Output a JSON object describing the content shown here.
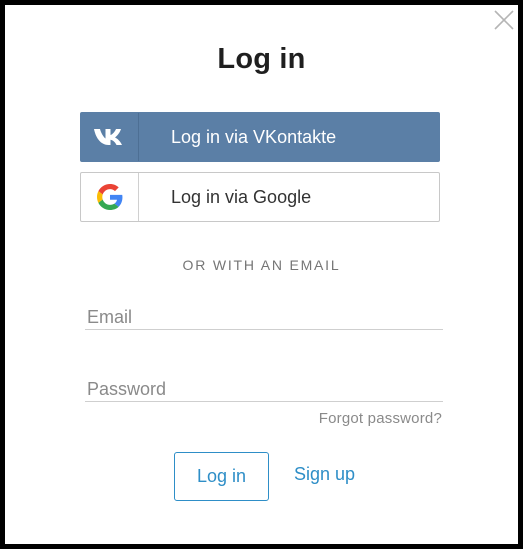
{
  "dialog": {
    "title": "Log in",
    "close_icon": "close-icon"
  },
  "social": {
    "vk": {
      "label": "Log in via VKontakte",
      "icon": "vk-logo-icon",
      "color": "#5b7fa6"
    },
    "google": {
      "label": "Log in via Google",
      "icon": "google-logo-icon"
    }
  },
  "divider": {
    "text": "OR WITH AN EMAIL"
  },
  "form": {
    "email": {
      "placeholder": "Email",
      "value": ""
    },
    "password": {
      "placeholder": "Password",
      "value": ""
    },
    "forgot_label": "Forgot password?",
    "login_label": "Log in",
    "signup_label": "Sign up",
    "accent_color": "#2e8ec7"
  }
}
